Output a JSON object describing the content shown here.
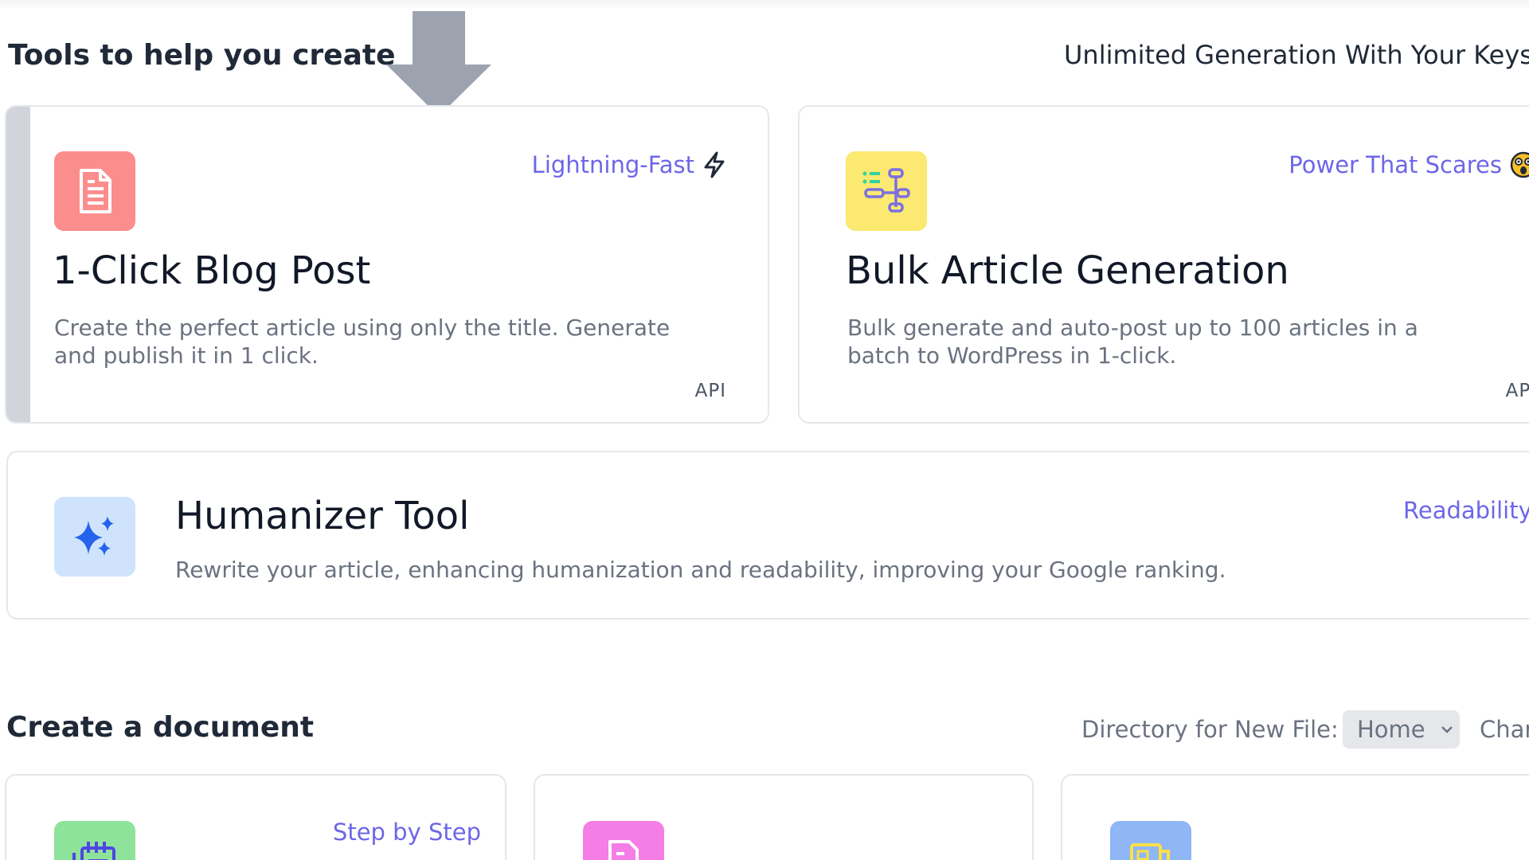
{
  "tools_section": {
    "title": "Tools to help you create",
    "right_note": "Unlimited Generation With Your Keys"
  },
  "cards": {
    "blog_post": {
      "badge": "Lightning-Fast",
      "badge_icon": "lightning-icon",
      "icon": "document-icon",
      "icon_color": "#fc8d8d",
      "title": "1-Click Blog Post",
      "desc_line1": "Create the perfect article using only the title. Generate",
      "desc_line2": "and publish it in 1 click.",
      "tag": "API"
    },
    "bulk_article": {
      "badge": "Power That Scares",
      "badge_icon": "scared-face-emoji",
      "icon": "workflow-icon",
      "icon_color": "#fbe971",
      "title": "Bulk Article Generation",
      "desc_line1": "Bulk generate and auto-post up to 100 articles in a",
      "desc_line2": "batch to WordPress in 1-click.",
      "tag": "API"
    },
    "humanizer": {
      "badge": "Readability",
      "icon": "sparkles-icon",
      "icon_color": "#cfe3fd",
      "title": "Humanizer Tool",
      "desc": "Rewrite your article, enhancing humanization and readability, improving your Google ranking."
    }
  },
  "documents_section": {
    "title": "Create a document",
    "directory_label": "Directory for New File:",
    "directory_value": "Home",
    "trailing_label": "Char"
  },
  "doc_cards": [
    {
      "icon": "notebook-icon",
      "icon_color": "#8ee39b",
      "badge": "Step by Step"
    },
    {
      "icon": "checklist-document-icon",
      "icon_color": "#f47de6",
      "badge": ""
    },
    {
      "icon": "newspaper-icon",
      "icon_color": "#8fb6f5",
      "badge": ""
    }
  ],
  "colors": {
    "accent": "#6d66e8",
    "arrow": "#9ca3af"
  }
}
